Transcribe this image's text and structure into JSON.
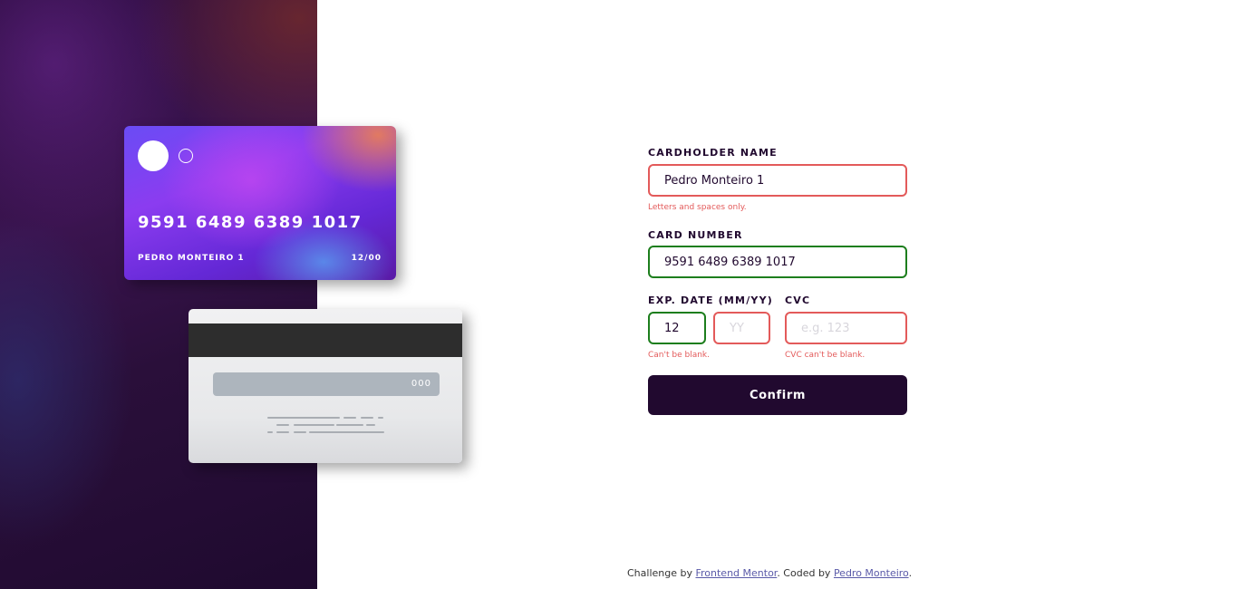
{
  "card_front": {
    "number": "9591 6489 6389 1017",
    "name": "PEDRO MONTEIRO 1",
    "expiry": "12/00"
  },
  "card_back": {
    "cvc": "000"
  },
  "form": {
    "cardholder": {
      "label": "CARDHOLDER NAME",
      "value": "Pedro Monteiro 1",
      "error": "Letters and spaces only."
    },
    "card_number": {
      "label": "CARD NUMBER",
      "value": "9591 6489 6389 1017"
    },
    "exp_date": {
      "label": "EXP. DATE (MM/YY)",
      "month_value": "12",
      "year_placeholder": "YY",
      "error": "Can't be blank."
    },
    "cvc": {
      "label": "CVC",
      "placeholder": "e.g. 123",
      "error": "CVC can't be blank."
    },
    "confirm_label": "Confirm"
  },
  "footer": {
    "prefix": "Challenge by ",
    "link1": "Frontend Mentor",
    "middle": ". Coded by ",
    "link2": "Pedro Monteiro",
    "suffix": "."
  },
  "colors": {
    "dark_violet": "#21092f",
    "error_red": "#e35a5a",
    "valid_green": "#1d7e1d",
    "link": "#5a5aa8"
  }
}
